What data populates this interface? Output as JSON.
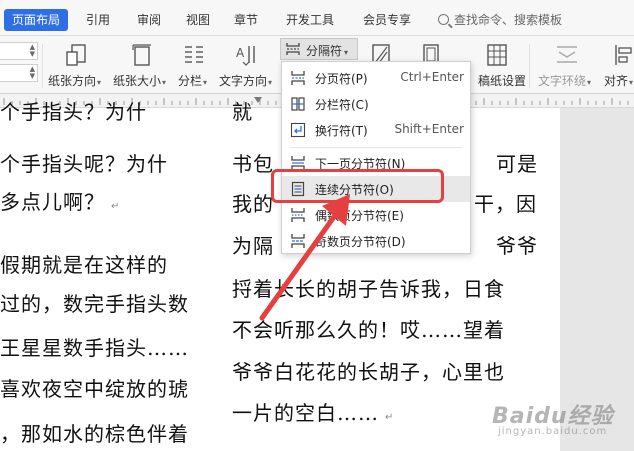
{
  "tabs": [
    {
      "label": "页面布局",
      "active": true
    },
    {
      "label": "引用"
    },
    {
      "label": "审阅"
    },
    {
      "label": "视图"
    },
    {
      "label": "章节"
    },
    {
      "label": "开发工具"
    },
    {
      "label": "会员专享"
    }
  ],
  "search": {
    "placeholder": "查找命令、搜索模板"
  },
  "ribbon": {
    "orientation_label": "纸张方向",
    "size_label": "纸张大小",
    "columns_label": "分栏",
    "text_direction_label": "文字方向",
    "divider_label": "分隔符",
    "paper_settings_label": "稿纸设置",
    "text_wrap_label": "文字环绕",
    "align_label": "对齐"
  },
  "menu": {
    "items": [
      {
        "label": "分页符(P)",
        "shortcut": "Ctrl+Enter",
        "icon": "page-break-icon"
      },
      {
        "label": "分栏符(C)",
        "shortcut": "",
        "icon": "column-break-icon"
      },
      {
        "label": "换行符(T)",
        "shortcut": "Shift+Enter",
        "icon": "line-break-icon"
      },
      {
        "label": "下一页分节符(N)",
        "shortcut": "",
        "icon": "next-page-section-icon"
      },
      {
        "label": "连续分节符(O)",
        "shortcut": "",
        "icon": "continuous-section-icon",
        "highlighted": true
      },
      {
        "label": "偶数页分节符(E)",
        "shortcut": "",
        "icon": "even-page-section-icon"
      },
      {
        "label": "奇数页分节符(D)",
        "shortcut": "",
        "icon": "odd-page-section-icon"
      }
    ]
  },
  "document": {
    "left_column": [
      "个手指头呢？为什",
      "多点儿啊？",
      "假期就是在这样的",
      "过的，数完手指头数",
      "王星星数手指头……",
      "喜欢夜空中绽放的琥",
      "，那如水的棕色伴着"
    ],
    "right_column": [
      "书包",
      "可是",
      "我的",
      "干，因",
      "为隔",
      "爷爷",
      "捋着长长的胡子告诉我，日食",
      "不会听那么久的！哎……望着",
      "爷爷白花花的长胡子，心里也",
      "一片的空白……"
    ]
  },
  "watermark": {
    "logo": "Baidu经验",
    "sub": "jingyan.baidu.com"
  },
  "colors": {
    "accent": "#2e6fe8",
    "highlight_border": "#e53f3f",
    "arrow": "#e53f3f"
  }
}
